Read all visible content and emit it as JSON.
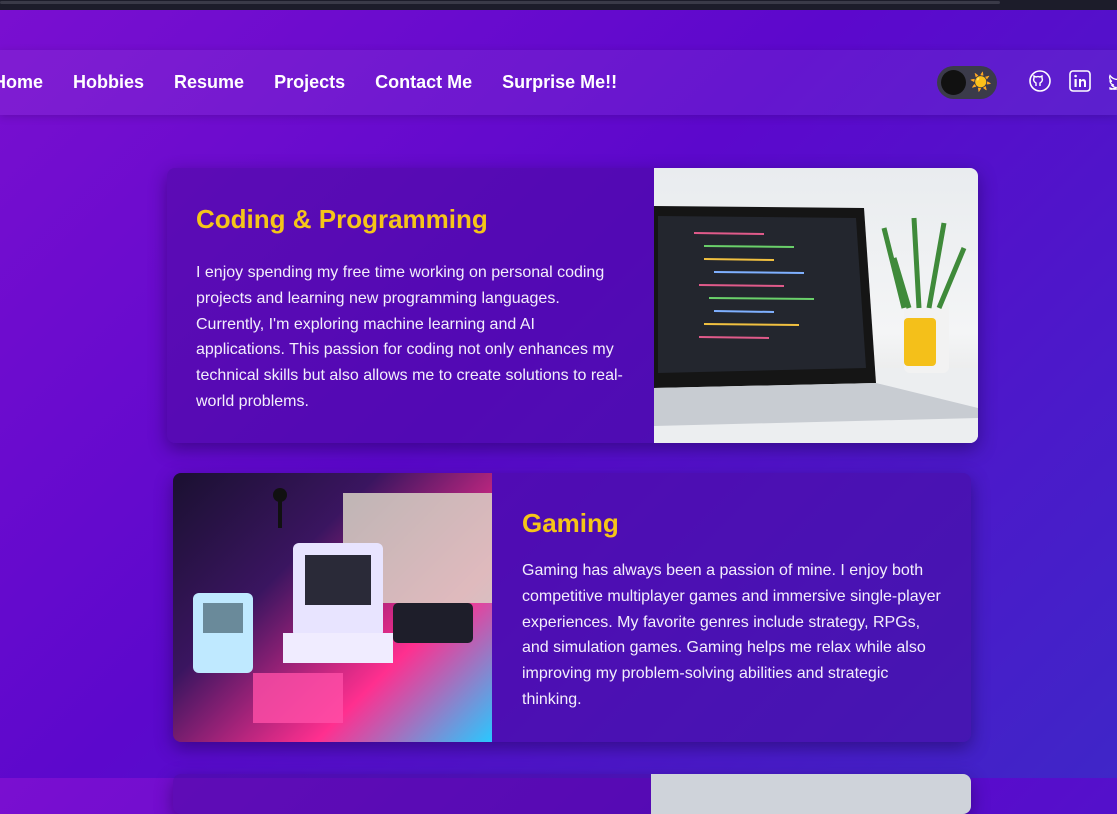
{
  "nav": {
    "links": [
      "Home",
      "Hobbies",
      "Resume",
      "Projects",
      "Contact Me",
      "Surprise Me!!"
    ]
  },
  "theme_toggle": {
    "icon": "sun-icon",
    "state": "dark"
  },
  "social": [
    "github-icon",
    "linkedin-icon",
    "twitter-icon"
  ],
  "hobbies": [
    {
      "title": "Coding & Programming",
      "description": "I enjoy spending my free time working on personal coding projects and learning new programming languages. Currently, I'm exploring machine learning and AI applications. This passion for coding not only enhances my technical skills but also allows me to create solutions to real-world problems.",
      "image": "laptop-code-photo"
    },
    {
      "title": "Gaming",
      "description": "Gaming has always been a passion of mine. I enjoy both competitive multiplayer games and immersive single-player experiences. My favorite genres include strategy, RPGs, and simulation games. Gaming helps me relax while also improving my problem-solving abilities and strategic thinking.",
      "image": "retro-computers-photo"
    }
  ],
  "colors": {
    "accent": "#f5c518",
    "text": "#ffffff"
  }
}
